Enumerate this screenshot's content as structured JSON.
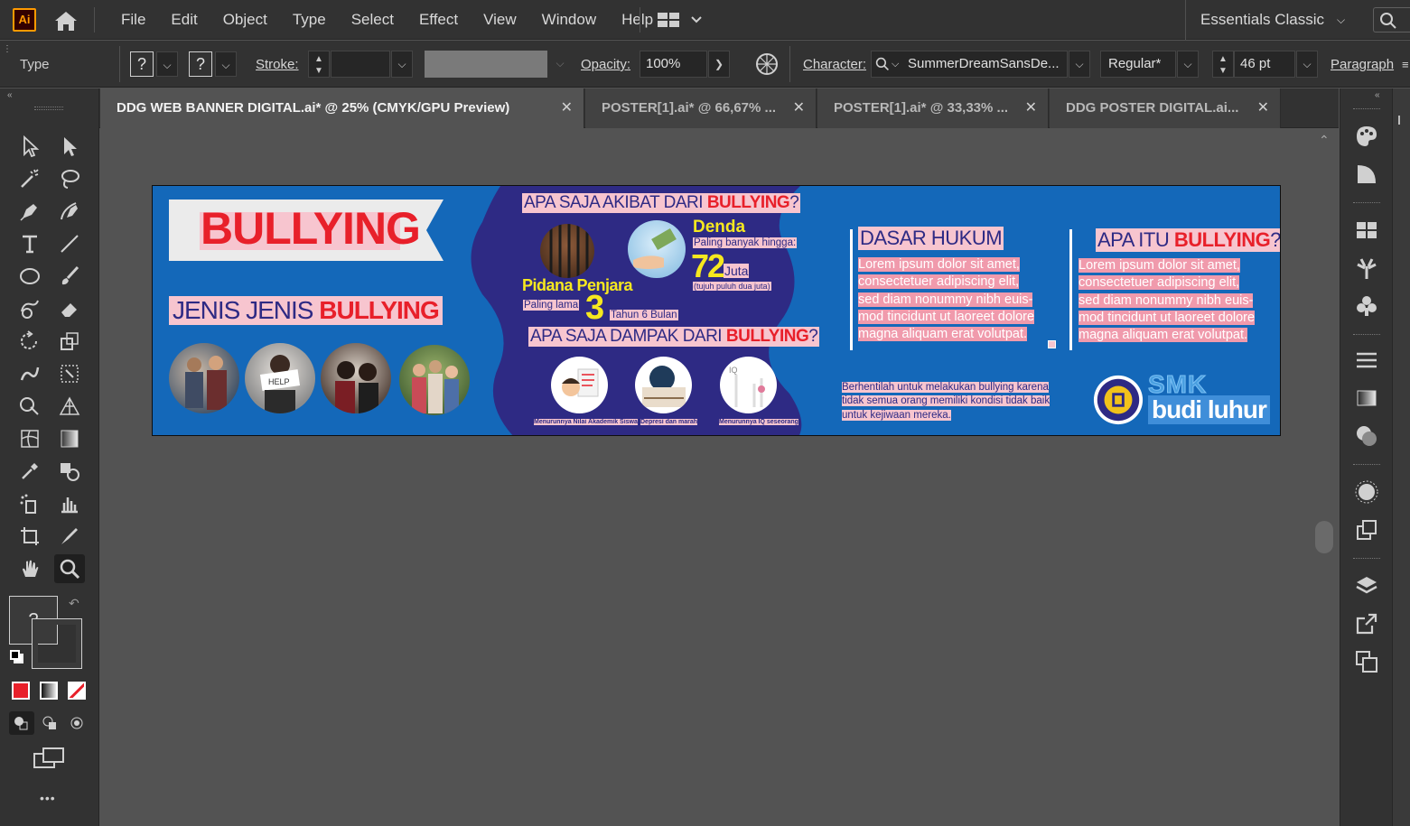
{
  "app": {
    "logo_text": "Ai"
  },
  "menu": [
    "File",
    "Edit",
    "Object",
    "Type",
    "Select",
    "Effect",
    "View",
    "Window",
    "Help"
  ],
  "workspace": {
    "label": "Essentials Classic"
  },
  "control_bar": {
    "selection_type": "Type",
    "fill_placeholder": "?",
    "stroke_placeholder": "?",
    "stroke_label": "Stroke:",
    "opacity_label": "Opacity:",
    "opacity_value": "100%",
    "character_label": "Character:",
    "font_family": "SummerDreamSansDe...",
    "font_style": "Regular*",
    "font_size": "46 pt",
    "paragraph_label": "Paragraph"
  },
  "tabs": [
    {
      "label": "DDG WEB BANNER DIGITAL.ai* @ 25% (CMYK/GPU Preview)",
      "active": true
    },
    {
      "label": "POSTER[1].ai* @ 66,67% ...",
      "active": false
    },
    {
      "label": "POSTER[1].ai* @ 33,33% ...",
      "active": false
    },
    {
      "label": "DDG POSTER DIGITAL.ai...",
      "active": false
    }
  ],
  "toolbar": {
    "fill_stroke_placeholder": "?",
    "more_label": "•••"
  },
  "banner": {
    "bullying_title": "BULLYING",
    "jenis_prefix": "JENIS JENIS ",
    "jenis_highlight": "BULLYING",
    "akibat_prefix": "APA SAJA AKIBAT DARI ",
    "akibat_highlight": "BULLYING",
    "akibat_suffix": "?",
    "denda_label": "Denda",
    "paling_banyak": "Paling banyak hingga:",
    "denda_number": "72",
    "juta": "Juta",
    "juta_words": "(tujuh puluh dua juta)",
    "pidana_label": "Pidana Penjara",
    "paling_lama": "Paling lama",
    "pidana_number": "3",
    "tahun": "Tahun 6 Bulan",
    "dampak_prefix": "APA SAJA DAMPAK DARI ",
    "dampak_highlight": "BULLYING",
    "dampak_suffix": "?",
    "impact_captions": [
      "Menurunnya Nilai Akademik Siswa",
      "Depresi dan marah",
      "Menurunnya IQ seseorang"
    ],
    "dasar_hukum": "DASAR HUKUM",
    "apa_itu_prefix": "APA ITU ",
    "apa_itu_highlight": "BULLYING",
    "apa_itu_suffix": "?",
    "lorem_lines": [
      "Lorem ipsum dolor sit amet,",
      "consectetuer adipiscing elit,",
      "sed diam nonummy nibh euis-",
      "mod tincidunt ut laoreet dolore",
      "magna aliquam erat volutpat."
    ],
    "stop_text": [
      "Berhentilah untuk melakukan bullying karena",
      "tidak semua orang memiliki kondisi tidak baik",
      "untuk kejiwaan mereka."
    ],
    "school_smk": "SMK",
    "school_name": "budi luhur"
  },
  "colors": {
    "banner_bg": "#1468b9",
    "mid_blob": "#2e2a84",
    "accent_red": "#e8202a",
    "highlight_pink": "#f7c5cf",
    "ui_dark": "#323232",
    "canvas": "#535353"
  }
}
